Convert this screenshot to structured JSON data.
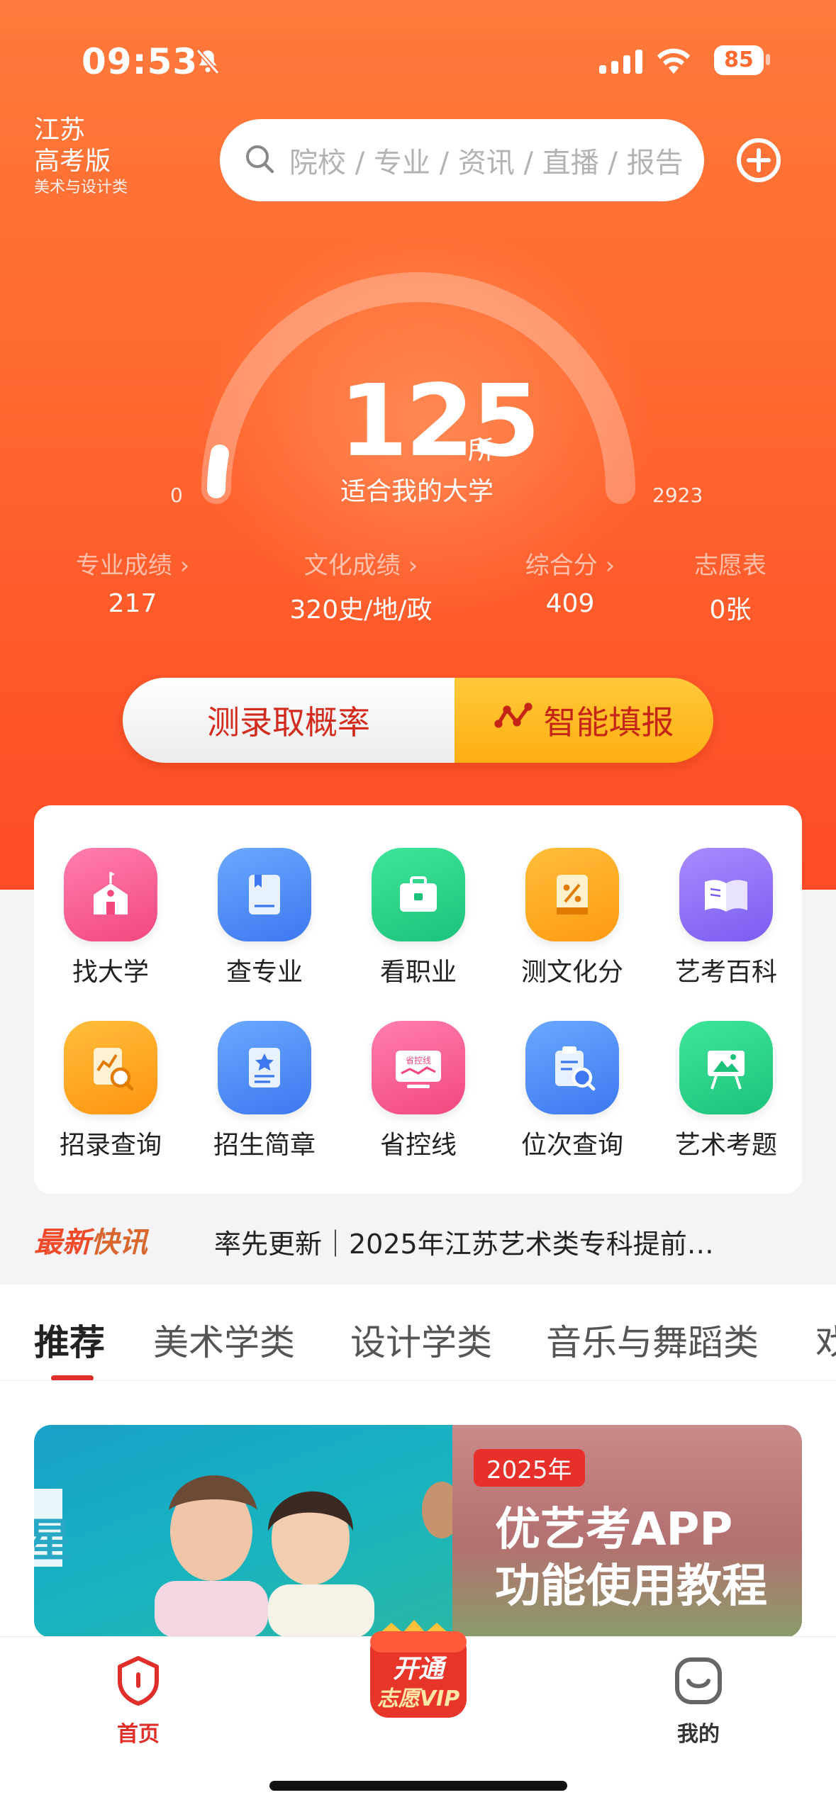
{
  "status_bar": {
    "time": "09:53",
    "battery": "85",
    "icons": [
      "bell-slash-icon",
      "cellular-signal-icon",
      "wifi-icon",
      "battery-icon"
    ]
  },
  "header": {
    "province": "江苏",
    "edition": "高考版",
    "category": "美术与设计类",
    "search_placeholder": "院校 / 专业 / 资讯 / 直播 / 报告"
  },
  "gauge": {
    "count": "125",
    "unit": "所",
    "label": "适合我的大学",
    "min": "0",
    "max": "2923"
  },
  "stats": [
    {
      "label": "专业成绩 ›",
      "value": "217"
    },
    {
      "label": "文化成绩 ›",
      "value": "320史/地/政"
    },
    {
      "label": "综合分 ›",
      "value": "409"
    },
    {
      "label": "志愿表",
      "value": "0张"
    }
  ],
  "cta": {
    "left": "测录取概率",
    "right": "智能填报"
  },
  "features": [
    {
      "label": "找大学",
      "icon": "school-icon"
    },
    {
      "label": "查专业",
      "icon": "book-icon"
    },
    {
      "label": "看职业",
      "icon": "briefcase-icon"
    },
    {
      "label": "测文化分",
      "icon": "percent-icon"
    },
    {
      "label": "艺考百科",
      "icon": "open-book-icon"
    },
    {
      "label": "招录查询",
      "icon": "chart-search-icon"
    },
    {
      "label": "招生简章",
      "icon": "brochure-icon"
    },
    {
      "label": "省控线",
      "icon": "control-line-icon"
    },
    {
      "label": "位次查询",
      "icon": "rank-search-icon"
    },
    {
      "label": "艺术考题",
      "icon": "easel-icon"
    }
  ],
  "control_line_badge": "省控线",
  "news": {
    "tag_a": "最新",
    "tag_b": "快讯",
    "text": "率先更新｜2025年江苏艺术类专科提前…"
  },
  "tabs": [
    "推荐",
    "美术学类",
    "设计学类",
    "音乐与舞蹈类",
    "戏"
  ],
  "banner": {
    "year": "2025年",
    "line1": "优艺考APP",
    "line2": "功能使用教程",
    "edge_text": "星"
  },
  "bottom_nav": {
    "home": "首页",
    "vip_line1": "开通",
    "vip_line2": "志愿VIP",
    "mine": "我的"
  },
  "colors": {
    "brand": "#ff5a2c",
    "accent_red": "#e02f2a",
    "cta_yellow": "#ffb21e"
  }
}
